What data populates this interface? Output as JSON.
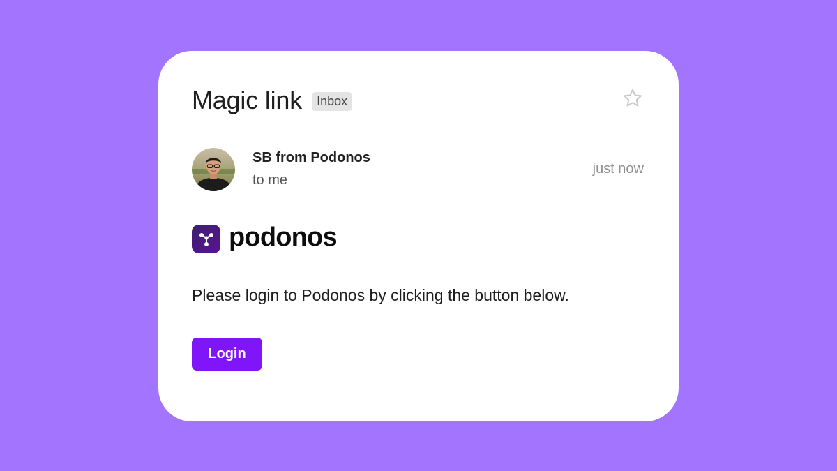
{
  "email": {
    "subject": "Magic link",
    "label": "Inbox",
    "sender": "SB from Podonos",
    "recipient": "to me",
    "time": "just now",
    "brand_name": "podonos",
    "body": "Please login to Podonos by clicking the button below.",
    "button_label": "Login"
  },
  "icons": {
    "star": "star-outline-icon",
    "avatar": "sender-avatar",
    "logo": "podonos-logo-icon"
  },
  "colors": {
    "background": "#a374fd",
    "button": "#7f15f8",
    "logo_mark": "#4a1a80"
  }
}
